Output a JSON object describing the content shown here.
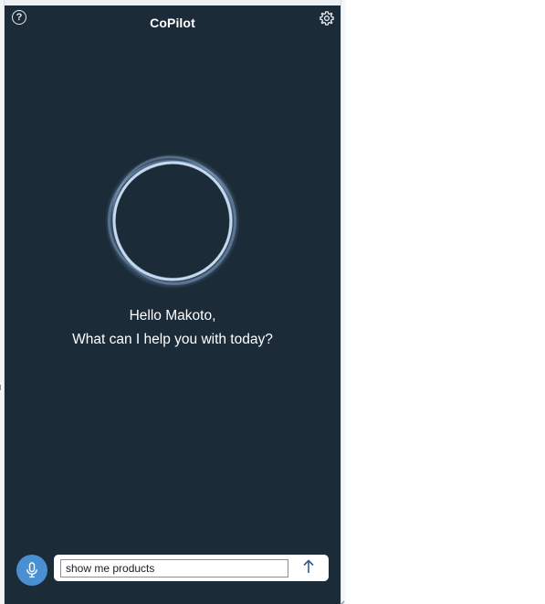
{
  "app": {
    "title": "CoPilot"
  },
  "header": {
    "help_icon": "help-circle-icon",
    "help_glyph": "?",
    "settings_icon": "gear-icon"
  },
  "assistant": {
    "orb_icon": "assistant-orb",
    "greeting_line1": "Hello Makoto,",
    "greeting_line2": "What can I help you with today?"
  },
  "composer": {
    "mic_icon": "microphone-icon",
    "input_value": "show me products",
    "send_icon": "arrow-up-icon"
  },
  "colors": {
    "panel_background": "#1c2b38",
    "accent": "#4a8fd1",
    "text": "#ffffff",
    "orb_ring": "#a9c4e3"
  }
}
